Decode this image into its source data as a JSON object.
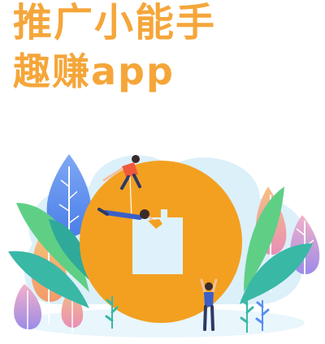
{
  "headline": {
    "line1": "推广小能手",
    "line2": "趣赚app"
  },
  "colors": {
    "accent": "#f5a63a",
    "coin": "#f3a021",
    "coin_hole": "#dff2fb",
    "cloud": "#dcf0fa",
    "leaf_green": "#5fcf86",
    "leaf_teal": "#39b8a6",
    "tree_blue": "#5b8ff0",
    "tree_pink": "#f2a3bd",
    "tree_orange": "#f6b46b",
    "tree_purple": "#a889e6"
  },
  "icons": [
    "coin-icon",
    "climber-figure",
    "hanging-figure",
    "cheering-figure",
    "tree-icon",
    "leaf-icon"
  ]
}
